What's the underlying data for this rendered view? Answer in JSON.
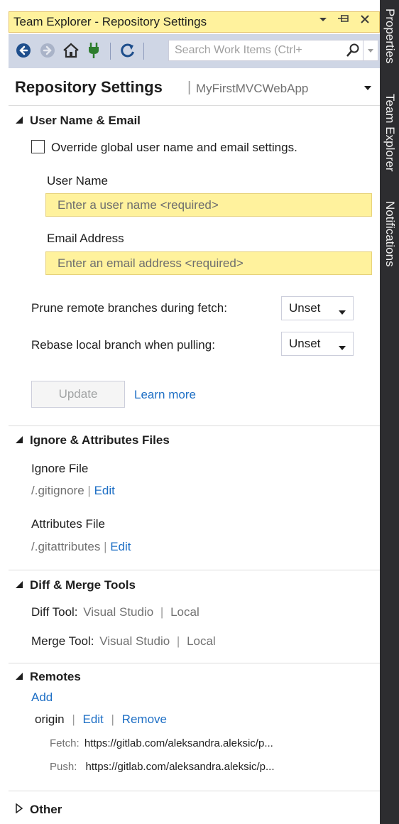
{
  "window": {
    "title": "Team Explorer - Repository Settings"
  },
  "toolbar": {
    "search_placeholder": "Search Work Items (Ctrl+"
  },
  "header": {
    "title": "Repository Settings",
    "separator": "|",
    "project": "MyFirstMVCWebApp"
  },
  "user_section": {
    "heading": "User Name & Email",
    "override_label": "Override global user name and email settings.",
    "override_checked": false,
    "user_name_label": "User Name",
    "user_name_placeholder": "Enter a user name <required>",
    "user_name_value": "",
    "email_label": "Email Address",
    "email_placeholder": "Enter an email address <required>",
    "email_value": "",
    "prune_label": "Prune remote branches during fetch:",
    "prune_value": "Unset",
    "rebase_label": "Rebase local branch when pulling:",
    "rebase_value": "Unset",
    "update_label": "Update",
    "learn_more": "Learn more"
  },
  "ignore_section": {
    "heading": "Ignore & Attributes Files",
    "ignore_label": "Ignore File",
    "ignore_path": "/.gitignore",
    "attributes_label": "Attributes File",
    "attributes_path": "/.gitattributes",
    "separator": "|",
    "edit": "Edit"
  },
  "diff_section": {
    "heading": "Diff & Merge Tools",
    "diff_label": "Diff Tool:",
    "merge_label": "Merge Tool:",
    "tool_value": "Visual Studio",
    "separator": "|",
    "local": "Local"
  },
  "remotes_section": {
    "heading": "Remotes",
    "add": "Add",
    "remote_name": "origin",
    "separator": "|",
    "edit": "Edit",
    "remove": "Remove",
    "fetch_label": "Fetch:",
    "fetch_url": "https://gitlab.com/aleksandra.aleksic/p...",
    "push_label": "Push:",
    "push_url": "https://gitlab.com/aleksandra.aleksic/p..."
  },
  "other_section": {
    "heading": "Other"
  },
  "side_tabs": [
    "Properties",
    "Team Explorer",
    "Notifications"
  ],
  "colors": {
    "title_bar": "#fff29d",
    "toolbar": "#cfd6e5",
    "side_bar": "#2d2d30",
    "link": "#1e6fc5",
    "input_bg": "#fff29d"
  }
}
